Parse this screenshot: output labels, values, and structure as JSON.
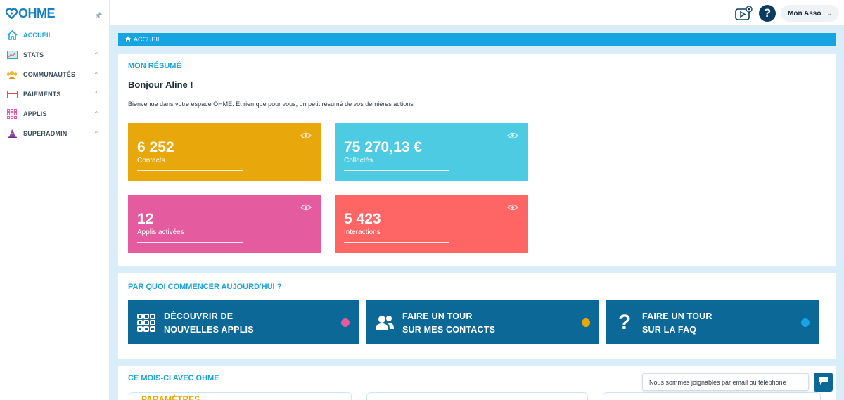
{
  "sidebar": {
    "logo": "OHME",
    "items": [
      {
        "label": "ACCUEIL",
        "icon": "home-icon",
        "active": true
      },
      {
        "label": "STATS",
        "icon": "stats-icon"
      },
      {
        "label": "COMMUNAUTÉS",
        "icon": "community-icon"
      },
      {
        "label": "PAIEMENTS",
        "icon": "card-icon"
      },
      {
        "label": "APPLIS",
        "icon": "apps-grid-icon"
      },
      {
        "label": "SUPERADMIN",
        "icon": "wizard-hat-icon"
      }
    ]
  },
  "topbar": {
    "help": "?",
    "account": "Mon Asso"
  },
  "breadcrumb": {
    "label": "ACCUEIL"
  },
  "summary": {
    "title": "MON RÉSUMÉ",
    "greeting": "Bonjour Aline !",
    "intro": "Bienvenue dans votre espace OHME. Et rien que pour vous, un petit résumé de vos dernières actions :",
    "stats": [
      {
        "value": "6 252",
        "label": "Contacts",
        "color": "#e8a80c"
      },
      {
        "value": "75 270,13 €",
        "label": "Collectés",
        "color": "#4ccbe3"
      },
      {
        "value": "12",
        "label": "Applis activées",
        "color": "#e45ba0"
      },
      {
        "value": "5 423",
        "label": "Interactions",
        "color": "#fd6664"
      }
    ]
  },
  "start": {
    "title": "PAR QUOI COMMENCER AUJOURD'HUI ?",
    "actions": [
      {
        "line1": "DÉCOUVRIR DE",
        "line2": "NOUVELLES APPLIS",
        "icon": "apps-grid-icon",
        "dot": "#e45ba0"
      },
      {
        "line1": "FAIRE UN TOUR",
        "line2": "SUR MES CONTACTS",
        "icon": "users-icon",
        "dot": "#e8a80c"
      },
      {
        "line1": "FAIRE UN TOUR",
        "line2": "SUR LA FAQ",
        "icon": "question-icon",
        "dot": "#17a5e2"
      }
    ]
  },
  "month": {
    "title": "CE MOIS-CI AVEC OHME",
    "first_box_label": "PARAMÈTRES"
  },
  "chat": {
    "message": "Nous sommes joignables par email ou téléphone"
  },
  "colors": {
    "accent": "#17a5e2",
    "dark_blue": "#0c6897",
    "navy": "#0c3b5f"
  }
}
